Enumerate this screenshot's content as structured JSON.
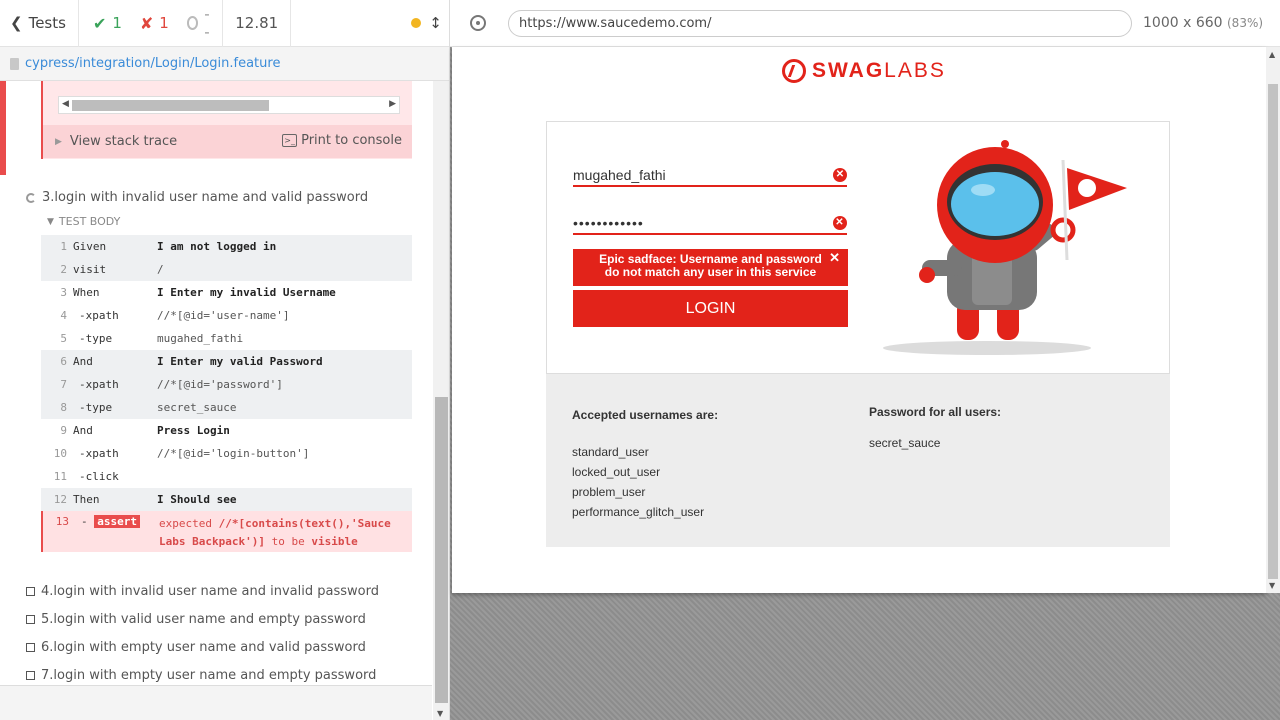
{
  "reporter": {
    "tests_label": "Tests",
    "passed": "1",
    "failed": "1",
    "pending": "--",
    "duration": "12.81",
    "spec_path": "cypress/integration/Login/Login.feature",
    "stack_trace_label": "View stack trace",
    "print_label": "Print to console",
    "test_title": "3.login with invalid user name and valid password",
    "test_body_label": "TEST BODY",
    "commands": [
      {
        "num": "1",
        "name": "Given",
        "msg": "I am not logged in",
        "bold": true
      },
      {
        "num": "2",
        "name": "visit",
        "msg": "/",
        "bold": false
      },
      {
        "num": "3",
        "name": "When",
        "msg": "I Enter my invalid Username",
        "bold": true
      },
      {
        "num": "4",
        "name": "-xpath",
        "msg": "//*[@id='user-name']",
        "bold": false
      },
      {
        "num": "5",
        "name": "-type",
        "msg": "mugahed_fathi",
        "bold": false
      },
      {
        "num": "6",
        "name": "And",
        "msg": "I Enter my valid Password",
        "bold": true
      },
      {
        "num": "7",
        "name": "-xpath",
        "msg": "//*[@id='password']",
        "bold": false
      },
      {
        "num": "8",
        "name": "-type",
        "msg": "secret_sauce",
        "bold": false
      },
      {
        "num": "9",
        "name": "And",
        "msg": "Press Login",
        "bold": true
      },
      {
        "num": "10",
        "name": "-xpath",
        "msg": "//*[@id='login-button']",
        "bold": false
      },
      {
        "num": "11",
        "name": "-click",
        "msg": "",
        "bold": false
      },
      {
        "num": "12",
        "name": "Then",
        "msg": "I Should see",
        "bold": true
      }
    ],
    "failed_command": {
      "num": "13",
      "name": "assert",
      "msg_prefix": "expected",
      "msg_target": "//*[contains(text(),'Sauce Labs Backpack')]",
      "msg_mid": "to be",
      "msg_suffix": "visible"
    },
    "pending_tests": [
      "4.login with invalid user name and invalid password",
      "5.login with valid user name and empty password",
      "6.login with empty user name and valid password",
      "7.login with empty user name and empty password"
    ]
  },
  "aut": {
    "url": "https://www.saucedemo.com/",
    "viewport": "1000 x 660",
    "scale": "(83%)"
  },
  "page": {
    "logo_left": "SWAG",
    "logo_right": "LABS",
    "username_value": "mugahed_fathi",
    "password_value": "••••••••••••",
    "error_message": "Epic sadface: Username and password do not match any user in this service",
    "login_button": "LOGIN",
    "accepted_title": "Accepted usernames are:",
    "usernames": [
      "standard_user",
      "locked_out_user",
      "problem_user",
      "performance_glitch_user"
    ],
    "password_title": "Password for all users:",
    "password_hint": "secret_sauce"
  },
  "colors": {
    "brand_red": "#e2231a",
    "pass_green": "#3aa35a",
    "fail_red": "#e94c4c",
    "link_blue": "#3a8bd8"
  }
}
